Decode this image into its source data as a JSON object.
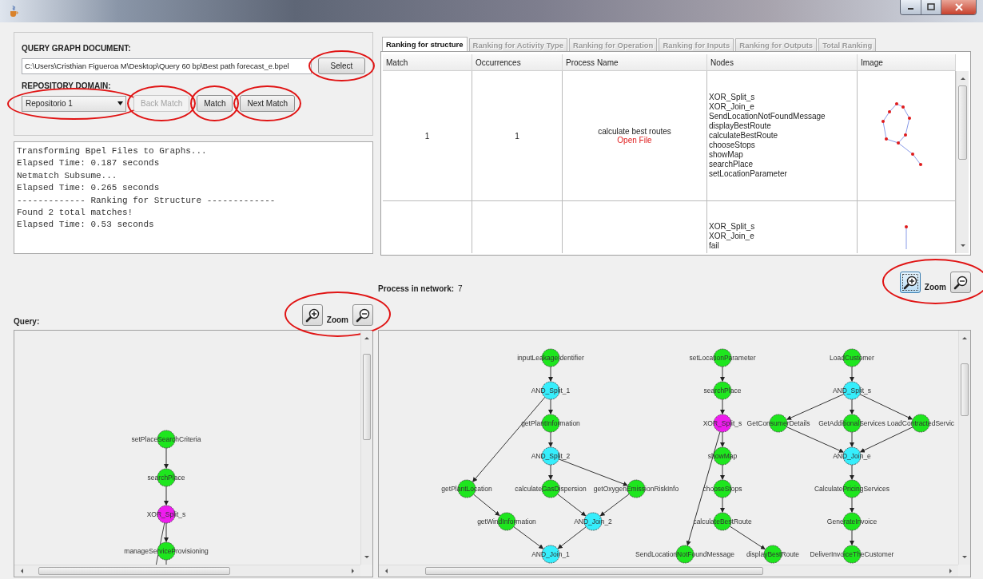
{
  "query_form": {
    "document_label": "QUERY GRAPH DOCUMENT:",
    "document_path": "C:\\Users\\Cristhian Figueroa M\\Desktop\\Query 60 bp\\Best path forecast_e.bpel",
    "select_button": {
      "label": "Select",
      "highlighted": true
    },
    "domain_label": "REPOSITORY DOMAIN:",
    "domain": {
      "value": "Repositorio 1",
      "highlighted": true
    },
    "buttons": [
      {
        "label": "Back Match",
        "disabled": true,
        "highlighted": true
      },
      {
        "label": "Match",
        "disabled": false,
        "highlighted": true
      },
      {
        "label": "Next Match",
        "disabled": false,
        "highlighted": true
      }
    ]
  },
  "log": {
    "lines": [
      "Transforming Bpel Files to Graphs...",
      "Elapsed Time: 0.187 seconds",
      "Netmatch Subsume...",
      "Elapsed Time: 0.265 seconds",
      "------------- Ranking for Structure -------------",
      "Found 2 total matches!",
      "Elapsed Time: 0.53 seconds"
    ]
  },
  "ranking": {
    "tabs": [
      {
        "label": "Ranking for structure",
        "selected": true,
        "disabled": false
      },
      {
        "label": "Ranking for Activity Type",
        "selected": false,
        "disabled": true
      },
      {
        "label": "Ranking for Operation",
        "selected": false,
        "disabled": true
      },
      {
        "label": "Ranking for Inputs",
        "selected": false,
        "disabled": true
      },
      {
        "label": "Ranking for Outputs",
        "selected": false,
        "disabled": true
      },
      {
        "label": "Total Ranking",
        "selected": false,
        "disabled": true
      }
    ],
    "columns": [
      "Match",
      "Occurrences",
      "Process Name",
      "Nodes",
      "Image"
    ],
    "rows": [
      {
        "match": "1",
        "occurrences": "1",
        "process_name": "calculate best routes",
        "link": "Open File",
        "nodes": [
          "XOR_Split_s",
          "XOR_Join_e",
          "SendLocationNotFoundMessage",
          "displayBestRoute",
          "calculateBestRoute",
          "chooseStops",
          "showMap",
          "searchPlace",
          "setLocationParameter"
        ],
        "image": {
          "kind": "cycle"
        }
      },
      {
        "nodes": [
          "XOR_Split_s",
          "XOR_Join_e",
          "fail"
        ],
        "image": {
          "kind": "chain"
        }
      }
    ]
  },
  "network": {
    "label": "Process in network:",
    "count": "7",
    "zoom": {
      "label": "Zoom",
      "highlighted": true,
      "zoom_in_focused": true
    },
    "graphs": [
      {
        "nodes": [
          {
            "label": "inputLeakageIdentifier",
            "kind": "activity"
          },
          {
            "label": "AND_Split_1",
            "kind": "and"
          },
          {
            "label": "getPlantInformation",
            "kind": "activity"
          },
          {
            "label": "AND_Split_2",
            "kind": "and"
          },
          {
            "label": "getPlantLocation",
            "kind": "activity"
          },
          {
            "label": "calculateGasDispersion",
            "kind": "activity"
          },
          {
            "label": "getOxygenEmissionRiskInfo",
            "kind": "activity"
          },
          {
            "label": "getWindInformation",
            "kind": "activity"
          },
          {
            "label": "AND_Join_2",
            "kind": "and"
          },
          {
            "label": "AND_Join_1",
            "kind": "and"
          }
        ]
      },
      {
        "nodes": [
          {
            "label": "setLocationParameter",
            "kind": "activity"
          },
          {
            "label": "searchPlace",
            "kind": "activity"
          },
          {
            "label": "XOR_Split_s",
            "kind": "xor"
          },
          {
            "label": "showMap",
            "kind": "activity"
          },
          {
            "label": "chooseStops",
            "kind": "activity"
          },
          {
            "label": "calculateBestRoute",
            "kind": "activity"
          },
          {
            "label": "SendLocationNotFoundMessage",
            "kind": "activity"
          },
          {
            "label": "displayBestRoute",
            "kind": "activity"
          }
        ]
      },
      {
        "nodes": [
          {
            "label": "LoadCustomer",
            "kind": "activity"
          },
          {
            "label": "AND_Split_s",
            "kind": "and"
          },
          {
            "label": "GetConsumerDetails",
            "kind": "activity"
          },
          {
            "label": "GetAdditionalServices",
            "kind": "activity"
          },
          {
            "label": "LoadContractedServic",
            "kind": "activity"
          },
          {
            "label": "AND_Join_e",
            "kind": "and"
          },
          {
            "label": "CalculatePricingServices",
            "kind": "activity"
          },
          {
            "label": "GenerateInvoice",
            "kind": "activity"
          },
          {
            "label": "DeliverInvoiceTheCustomer",
            "kind": "activity"
          }
        ]
      }
    ]
  },
  "query": {
    "label": "Query:",
    "zoom": {
      "label": "Zoom",
      "highlighted": true,
      "zoom_in_focused": false
    },
    "graph": {
      "nodes": [
        {
          "label": "setPlaceSearchCriteria",
          "kind": "activity"
        },
        {
          "label": "searchPlace",
          "kind": "activity"
        },
        {
          "label": "XOR_Split_s",
          "kind": "xor"
        },
        {
          "label": "manageServiceProvisioning",
          "kind": "activity"
        }
      ]
    }
  }
}
